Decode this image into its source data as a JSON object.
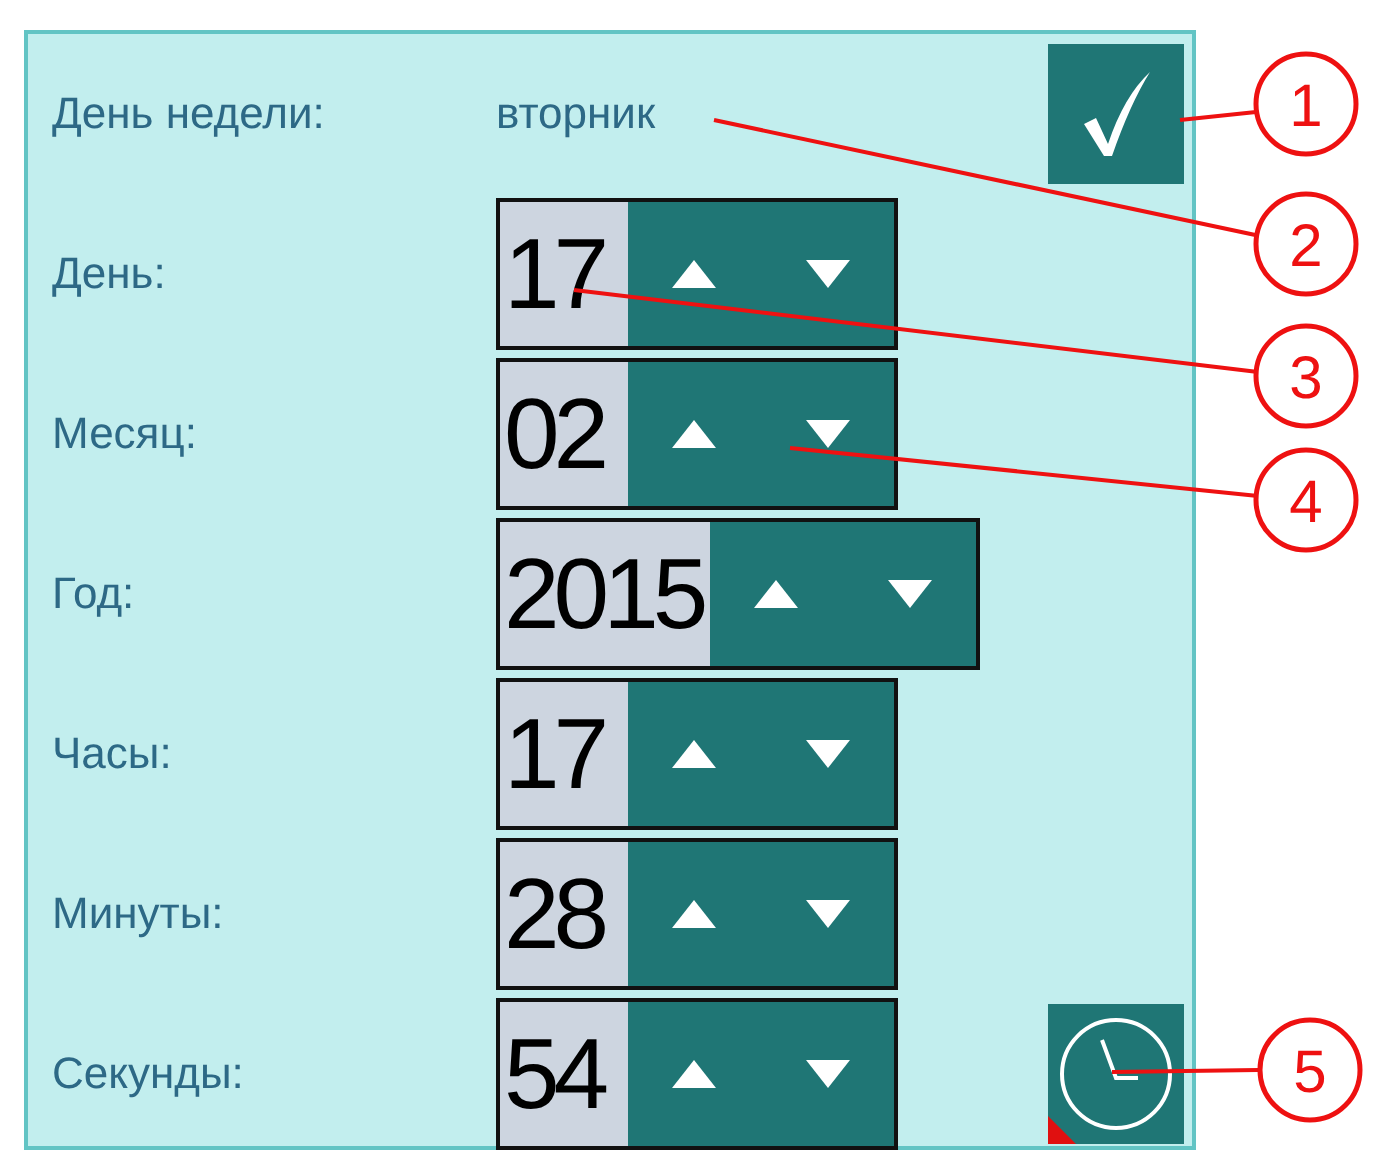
{
  "fields": [
    {
      "kind": "text",
      "label": "День недели:",
      "value": "вторник"
    },
    {
      "kind": "spinner",
      "label": "День:",
      "value": "17"
    },
    {
      "kind": "spinner",
      "label": "Месяц:",
      "value": "02"
    },
    {
      "kind": "spinner",
      "label": "Год:",
      "value": "2015"
    },
    {
      "kind": "spinner",
      "label": "Часы:",
      "value": "17"
    },
    {
      "kind": "spinner",
      "label": "Минуты:",
      "value": "28"
    },
    {
      "kind": "spinner",
      "label": "Секунды:",
      "value": "54"
    }
  ],
  "callouts": [
    {
      "number": "1"
    },
    {
      "number": "2"
    },
    {
      "number": "3"
    },
    {
      "number": "4"
    },
    {
      "number": "5"
    }
  ]
}
